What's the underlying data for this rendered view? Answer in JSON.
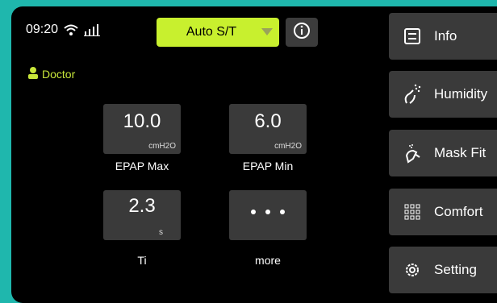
{
  "status": {
    "time": "09:20"
  },
  "mode": {
    "label": "Auto S/T"
  },
  "role": {
    "label": "Doctor"
  },
  "params": [
    {
      "value": "10.0",
      "unit": "cmH2O",
      "label": "EPAP Max"
    },
    {
      "value": "6.0",
      "unit": "cmH2O",
      "label": "EPAP Min"
    },
    {
      "value": "2.3",
      "unit": "s",
      "label": "Ti"
    },
    {
      "label": "more"
    }
  ],
  "menu": [
    {
      "label": "Info",
      "icon": "list-icon"
    },
    {
      "label": "Humidity",
      "icon": "humidity-icon"
    },
    {
      "label": "Mask Fit",
      "icon": "mask-icon"
    },
    {
      "label": "Comfort",
      "icon": "grid-icon"
    },
    {
      "label": "Setting",
      "icon": "gear-icon"
    }
  ],
  "colors": {
    "accent": "#c8f02e",
    "frame": "#1fb7ad",
    "button": "#3a3a3a"
  }
}
